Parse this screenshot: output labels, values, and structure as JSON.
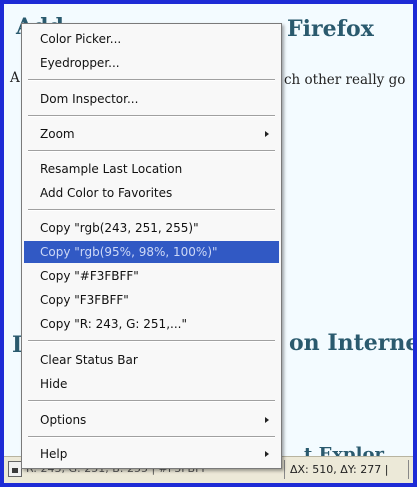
{
  "page": {
    "heading_top": "Add-ons That I ... Firefox",
    "heading_top_visible": "Firefox",
    "heading_top_frag": "Add",
    "body_fragment": "ch other really go",
    "left_letter": "A",
    "heading_mid": "on Interne",
    "heading_mid_left": "I",
    "heading_bottom_frag": "t Explor"
  },
  "menu": {
    "items": [
      {
        "label": "Color Picker..."
      },
      {
        "label": "Eyedropper..."
      },
      {
        "label": "Dom Inspector..."
      },
      {
        "label": "Zoom"
      },
      {
        "label": "Resample Last Location"
      },
      {
        "label": "Add Color to Favorites"
      },
      {
        "label": "Copy \"rgb(243, 251, 255)\""
      },
      {
        "label": "Copy \"rgb(95%, 98%, 100%)\""
      },
      {
        "label": "Copy \"#F3FBFF\""
      },
      {
        "label": "Copy \"F3FBFF\""
      },
      {
        "label": "Copy \"R: 243, G: 251,...\""
      },
      {
        "label": "Clear Status Bar"
      },
      {
        "label": "Hide"
      },
      {
        "label": "Options"
      },
      {
        "label": "Help"
      }
    ]
  },
  "statusbar": {
    "left_text": "R: 243, G: 251, B: 255 | #F3FBFF",
    "delta_text": "ΔX: 510, ΔY: 277 |"
  },
  "colors": {
    "frame": "#1d2bd6",
    "page_bg": "#f3fbff",
    "highlight": "#3159c4",
    "heading": "#2a5a6e"
  }
}
